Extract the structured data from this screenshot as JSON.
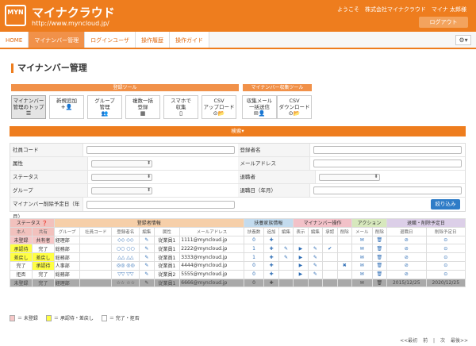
{
  "header": {
    "logo_text": "MYN",
    "title": "マイナクラウド",
    "url": "http://www.myncloud.jp/",
    "welcome": "ようこそ　株式会社マイナクラウド　マイナ 太郎様",
    "logout_label": "ログアウト"
  },
  "nav": {
    "tabs": [
      {
        "label": "HOME"
      },
      {
        "label": "マイナンバー管理"
      },
      {
        "label": "ログインユーザ"
      },
      {
        "label": "操作履歴"
      },
      {
        "label": "操作ガイド"
      }
    ],
    "gear_label": "⚙▾"
  },
  "page_title": "マイナンバー管理",
  "tools": {
    "reg_head": "登録ツール",
    "collect_head": "マイナンバー収集ツール",
    "buttons": [
      {
        "l1": "マイナンバー",
        "l2": "管理のトップ",
        "icon": "☰"
      },
      {
        "l1": "新規追加",
        "l2": "",
        "icon": "+👤"
      },
      {
        "l1": "グループ",
        "l2": "管理",
        "icon": "👥"
      },
      {
        "l1": "複数一括",
        "l2": "登録",
        "icon": "▦"
      },
      {
        "l1": "スマホで",
        "l2": "収集",
        "icon": "▯"
      },
      {
        "l1": "CSV",
        "l2": "アップロード",
        "icon": "⊙📂"
      },
      {
        "l1": "収集メール",
        "l2": "一括送信",
        "icon": "✉👤"
      },
      {
        "l1": "CSV",
        "l2": "ダウンロード",
        "icon": "⊙📂"
      }
    ]
  },
  "search_label": "検索▾",
  "form": {
    "employee_code": "社員コード",
    "employee_name": "登録者名",
    "attribute": "属性",
    "email": "メールアドレス",
    "status": "ステータス",
    "retired": "退職者",
    "group": "グループ",
    "retire_date": "退職日（年月）",
    "delete_date": "マイナンバー削除予定日（年月）",
    "filter_button": "絞り込み"
  },
  "table": {
    "groups": {
      "status": "ステータス",
      "reg": "登録者情報",
      "dep": "扶養家族情報",
      "my": "マイナンバー操作",
      "act": "アクション",
      "ret": "退職・削除予定日"
    },
    "cols": [
      "本人",
      "共有",
      "グループ",
      "社員コード",
      "登録者名",
      "編集",
      "属性",
      "メールアドレス",
      "扶養数",
      "追加",
      "編集",
      "表示",
      "編集",
      "承認",
      "削除",
      "メール",
      "削除",
      "退職日",
      "削除予定日"
    ],
    "rows": [
      {
        "self": "未登録",
        "share": "共有者",
        "group": "経理部",
        "code": "",
        "name": "◇◇ ◇◇",
        "attr": "従業員1",
        "email": "1111@myncloud.jp",
        "deps": "0",
        "show": "",
        "edit2": "",
        "approve": "",
        "del": "",
        "retire": "",
        "deldate": "",
        "self_cls": "status-red",
        "share_cls": "status-red"
      },
      {
        "self": "承認待",
        "share": "完了",
        "group": "総務部",
        "code": "",
        "name": "○○ ○○",
        "attr": "従業員1",
        "email": "2222@myncloud.jp",
        "deps": "1",
        "show": "▶",
        "edit2": "✎",
        "approve": "✔",
        "del": "",
        "retire": "",
        "deldate": "",
        "self_cls": "status-yel",
        "share_cls": ""
      },
      {
        "self": "差戻し",
        "share": "差戻し",
        "group": "総務部",
        "code": "",
        "name": "△△ △△",
        "attr": "従業員1",
        "email": "3333@myncloud.jp",
        "deps": "1",
        "show": "▶",
        "edit2": "✎",
        "approve": "",
        "del": "",
        "retire": "",
        "deldate": "",
        "self_cls": "status-yel",
        "share_cls": "status-yel"
      },
      {
        "self": "完了",
        "share": "承認待",
        "group": "人事部",
        "code": "",
        "name": "◎◎ ◎◎",
        "attr": "従業員1",
        "email": "4444@myncloud.jp",
        "deps": "0",
        "show": "▶",
        "edit2": "✎",
        "approve": "",
        "del": "✖",
        "retire": "",
        "deldate": "",
        "self_cls": "",
        "share_cls": "status-yel"
      },
      {
        "self": "拒否",
        "share": "完了",
        "group": "総務部",
        "code": "",
        "name": "▽▽ ▽▽",
        "attr": "従業員2",
        "email": "5555@myncloud.jp",
        "deps": "0",
        "show": "▶",
        "edit2": "✎",
        "approve": "",
        "del": "",
        "retire": "",
        "deldate": "",
        "self_cls": "",
        "share_cls": ""
      },
      {
        "self": "未登録",
        "share": "完了",
        "group": "経理部",
        "code": "",
        "name": "☆☆ ☆☆",
        "attr": "従業員1",
        "email": "6666@myncloud.jp",
        "deps": "0",
        "show": "",
        "edit2": "",
        "approve": "",
        "del": "",
        "retire": "2015/12/25",
        "deldate": "2020/12/25",
        "self_cls": "",
        "share_cls": "",
        "gray": true
      }
    ]
  },
  "legend": {
    "red": "＝ 未登録",
    "yellow": "＝ 承認待・差戻し",
    "white": "＝ 完了・拒否"
  },
  "pager": {
    "first": "<<最初",
    "prev": "前",
    "next": "次",
    "last": "最後>>"
  }
}
